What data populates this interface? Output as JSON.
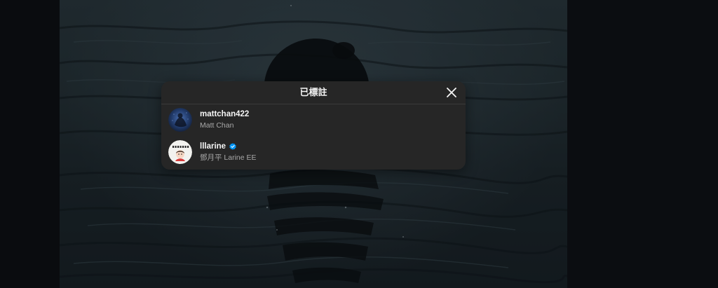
{
  "modal": {
    "title": "已標註",
    "close_label": "close"
  },
  "tagged_users": [
    {
      "username": "mattchan422",
      "full_name": "Matt Chan",
      "verified": false
    },
    {
      "username": "lllarine",
      "full_name": "鄧月平 Larine EE",
      "verified": true
    }
  ],
  "colors": {
    "modal_bg": "#262626",
    "verified_badge": "#0095f6",
    "subtext": "#a8a8a8"
  },
  "icons": {
    "close": "close-icon",
    "verified": "verified-badge-icon"
  }
}
